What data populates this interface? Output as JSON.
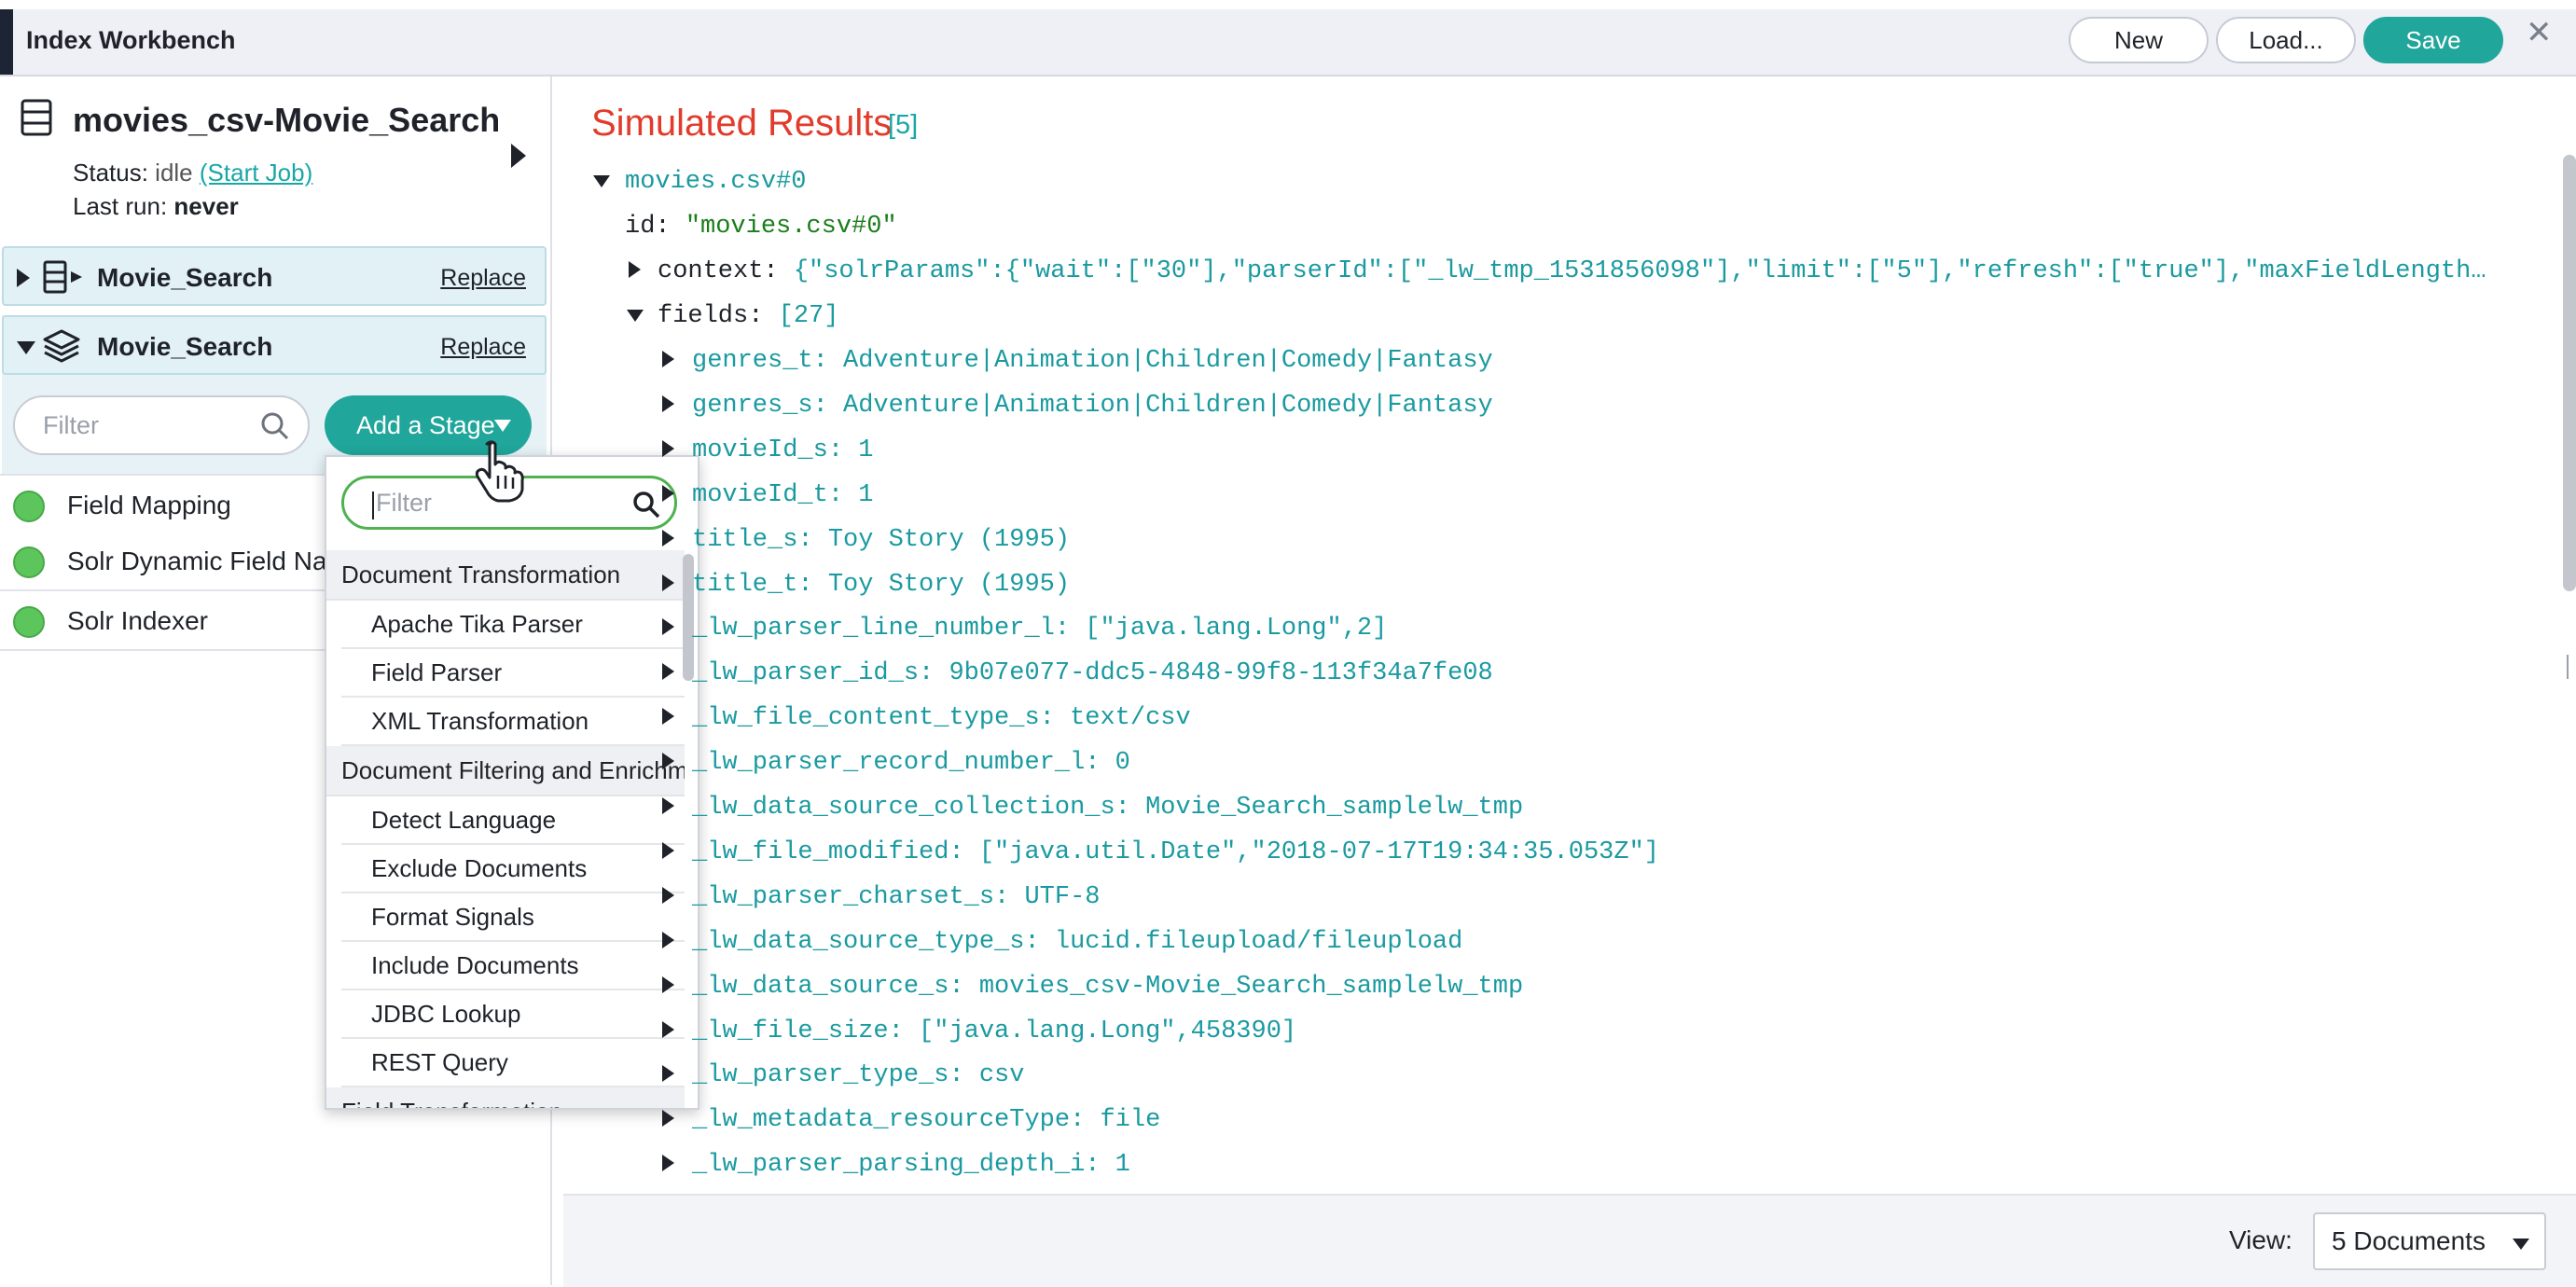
{
  "app": {
    "title": "Index Workbench",
    "buttons": {
      "new": "New",
      "load": "Load...",
      "save": "Save"
    },
    "colors": {
      "accent": "#20a69a",
      "error_title": "#e13b2b",
      "link": "#1aa6a6"
    }
  },
  "job": {
    "title": "movies_csv-Movie_Search",
    "status_label": "Status:",
    "status_value": "idle",
    "start_job_link": "(Start Job)",
    "last_run_label": "Last run:",
    "last_run_value": "never"
  },
  "sections": [
    {
      "label": "Movie_Search",
      "action": "Replace",
      "expanded": false,
      "icon": "datasource-icon"
    },
    {
      "label": "Movie_Search",
      "action": "Replace",
      "expanded": true,
      "icon": "layers-icon"
    }
  ],
  "pipeline": {
    "filter_placeholder": "Filter",
    "add_stage_label": "Add a Stage",
    "stages": [
      {
        "name": "Field Mapping",
        "status": "green"
      },
      {
        "name": "Solr Dynamic Field Na",
        "status": "green"
      },
      {
        "name": "Solr Indexer",
        "status": "green"
      }
    ]
  },
  "stage_menu": {
    "filter_placeholder": "Filter",
    "groups": [
      {
        "label": "Document Transformation",
        "items": [
          "Apache Tika Parser",
          "Field Parser",
          "XML Transformation"
        ]
      },
      {
        "label": "Document Filtering and Enrichm",
        "items": [
          "Detect Language",
          "Exclude Documents",
          "Format Signals",
          "Include Documents",
          "JDBC Lookup",
          "REST Query"
        ]
      },
      {
        "label": "Field Transformation",
        "items": []
      }
    ]
  },
  "results": {
    "title": "Simulated Results",
    "count": "[5]",
    "doc_label": "movies.csv#0",
    "id_key": "id:",
    "id_value": "\"movies.csv#0\"",
    "context_key": "context:",
    "context_value": "{\"solrParams\":{\"wait\":[\"30\"],\"parserId\":[\"_lw_tmp_1531856098\"],\"limit\":[\"5\"],\"refresh\":[\"true\"],\"maxFieldLength…",
    "fields_key": "fields:",
    "fields_count": "[27]",
    "fields": [
      {
        "text": "genres_t: Adventure|Animation|Children|Comedy|Fantasy",
        "arrow": true
      },
      {
        "text": "genres_s: Adventure|Animation|Children|Comedy|Fantasy",
        "arrow": true
      },
      {
        "text": "movieId_s: 1",
        "arrow": true
      },
      {
        "text": "movieId_t: 1",
        "arrow": true
      },
      {
        "text": "title_s: Toy Story (1995)",
        "arrow": true
      },
      {
        "text": "title_t: Toy Story (1995)",
        "arrow": true
      },
      {
        "text": "_lw_parser_line_number_l: [\"java.lang.Long\",2]",
        "arrow": true
      },
      {
        "text": "_lw_parser_id_s: 9b07e077-ddc5-4848-99f8-113f34a7fe08",
        "arrow": true
      },
      {
        "text": "_lw_file_content_type_s: text/csv",
        "arrow": true
      },
      {
        "text": "_lw_parser_record_number_l: 0",
        "arrow": true
      },
      {
        "text": "_lw_data_source_collection_s: Movie_Search_samplelw_tmp",
        "arrow": true
      },
      {
        "text": "_lw_file_modified: [\"java.util.Date\",\"2018-07-17T19:34:35.053Z\"]",
        "arrow": true
      },
      {
        "text": "_lw_parser_charset_s: UTF-8",
        "arrow": true
      },
      {
        "text": "_lw_data_source_type_s: lucid.fileupload/fileupload",
        "arrow": true
      },
      {
        "text": "_lw_data_source_s: movies_csv-Movie_Search_samplelw_tmp",
        "arrow": true
      },
      {
        "text": "_lw_file_size: [\"java.lang.Long\",458390]",
        "arrow": true
      },
      {
        "text": "_lw_parser_type_s: csv",
        "arrow": true
      },
      {
        "text": "_lw_metadata_resourceType: file",
        "arrow": true
      },
      {
        "text": "_lw_parser_parsing_depth_i: 1",
        "arrow": true
      }
    ]
  },
  "view": {
    "label": "View:",
    "selected": "5 Documents"
  }
}
